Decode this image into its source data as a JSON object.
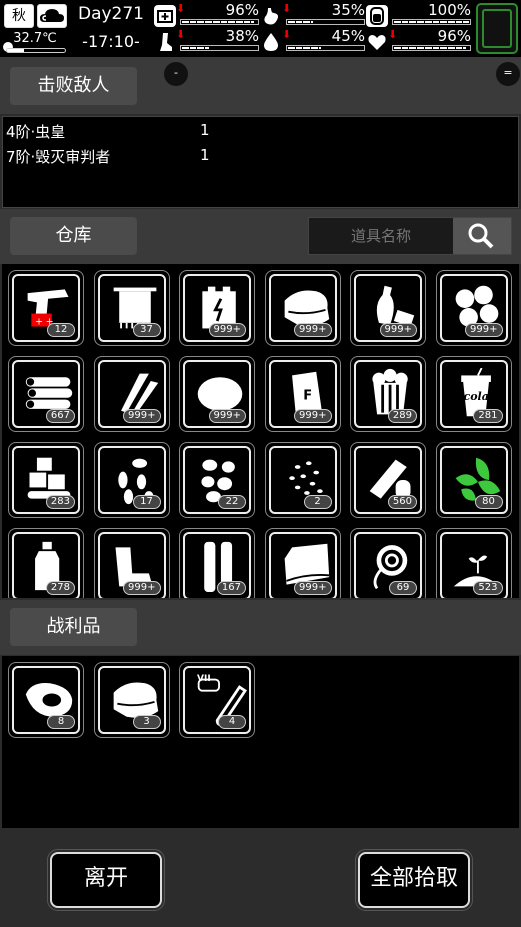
{
  "status_bar": {
    "season": "秋",
    "temperature": "32.7℃",
    "day": "Day271",
    "time": "-17:10-",
    "stats": [
      {
        "icon": "first-aid-icon",
        "value": "96%",
        "level": 0.96
      },
      {
        "icon": "stomach-icon",
        "value": "35%",
        "level": 0.35
      },
      {
        "icon": "stamina-icon",
        "value": "100%",
        "level": 1.0
      },
      {
        "icon": "leg-icon",
        "value": "38%",
        "level": 0.38
      },
      {
        "icon": "water-drop-icon",
        "value": "45%",
        "level": 0.45
      },
      {
        "icon": "heart-icon",
        "value": "96%",
        "level": 0.96
      }
    ]
  },
  "defeated": {
    "title": "击败敌人",
    "minimize": "-",
    "menu": "=",
    "enemies": [
      {
        "name": "4阶·虫皇",
        "count": "1"
      },
      {
        "name": "7阶·毁灭审判者",
        "count": "1"
      }
    ]
  },
  "warehouse": {
    "title": "仓库",
    "search_placeholder": "道具名称",
    "items": [
      {
        "icon": "flare-gun-icon",
        "count": "12"
      },
      {
        "icon": "towel-icon",
        "count": "37"
      },
      {
        "icon": "battery-icon",
        "count": "999+"
      },
      {
        "icon": "cloth-icon",
        "count": "999+"
      },
      {
        "icon": "plastic-bottles-icon",
        "count": "999+"
      },
      {
        "icon": "cotton-icon",
        "count": "999+"
      },
      {
        "icon": "logs-icon",
        "count": "667"
      },
      {
        "icon": "screws-icon",
        "count": "999+"
      },
      {
        "icon": "fur-icon",
        "count": "999+"
      },
      {
        "icon": "flour-bag-icon",
        "count": "999+"
      },
      {
        "icon": "popcorn-icon",
        "count": "289"
      },
      {
        "icon": "cola-cup-icon",
        "count": "281",
        "label": "cola"
      },
      {
        "icon": "ice-cubes-icon",
        "count": "283"
      },
      {
        "icon": "seeds-icon",
        "count": "17"
      },
      {
        "icon": "beans-icon",
        "count": "22"
      },
      {
        "icon": "small-seeds-icon",
        "count": "2"
      },
      {
        "icon": "bandage-roll-icon",
        "count": "560"
      },
      {
        "icon": "herb-leaves-icon",
        "count": "80"
      },
      {
        "icon": "water-bottle-icon",
        "count": "278"
      },
      {
        "icon": "parts-icon",
        "count": "999+"
      },
      {
        "icon": "tubes-icon",
        "count": "167"
      },
      {
        "icon": "fabric-icon",
        "count": "999+"
      },
      {
        "icon": "rope-icon",
        "count": "69"
      },
      {
        "icon": "soil-sprout-icon",
        "count": "523"
      }
    ]
  },
  "loot": {
    "title": "战利品",
    "items": [
      {
        "icon": "raw-meat-icon",
        "count": "8"
      },
      {
        "icon": "cloth-icon",
        "count": "3"
      },
      {
        "icon": "test-tube-icon",
        "count": "4",
        "label": "VII"
      }
    ]
  },
  "actions": {
    "leave": "离开",
    "pick_all": "全部拾取"
  },
  "colors": {
    "accent_green": "#2d8a2d",
    "alert_red": "#e00000",
    "herb_green": "#3ec83e"
  }
}
